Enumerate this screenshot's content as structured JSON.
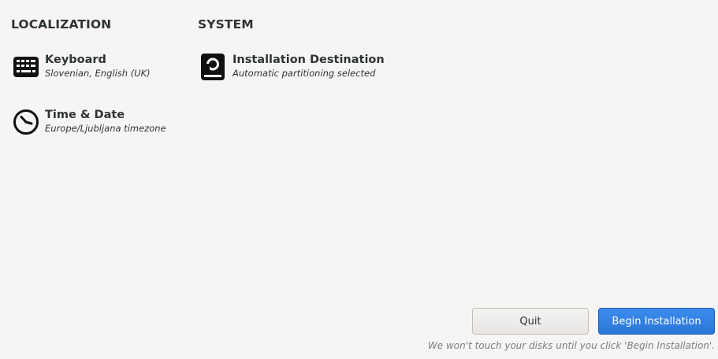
{
  "localization": {
    "title": "LOCALIZATION",
    "keyboard": {
      "name": "Keyboard",
      "status": "Slovenian, English (UK)",
      "icon": "keyboard-icon"
    },
    "time_date": {
      "name": "Time & Date",
      "status": "Europe/Ljubljana timezone",
      "icon": "clock-icon"
    }
  },
  "system": {
    "title": "SYSTEM",
    "installation_destination": {
      "name": "Installation Destination",
      "status": "Automatic partitioning selected",
      "icon": "disk-icon"
    }
  },
  "actions": {
    "quit_label": "Quit",
    "begin_label": "Begin Installation",
    "note": "We won't touch your disks until you click 'Begin Installation'."
  },
  "colors": {
    "background": "#f6f5f4",
    "accent": "#2a76d6",
    "text": "#2e3436"
  }
}
